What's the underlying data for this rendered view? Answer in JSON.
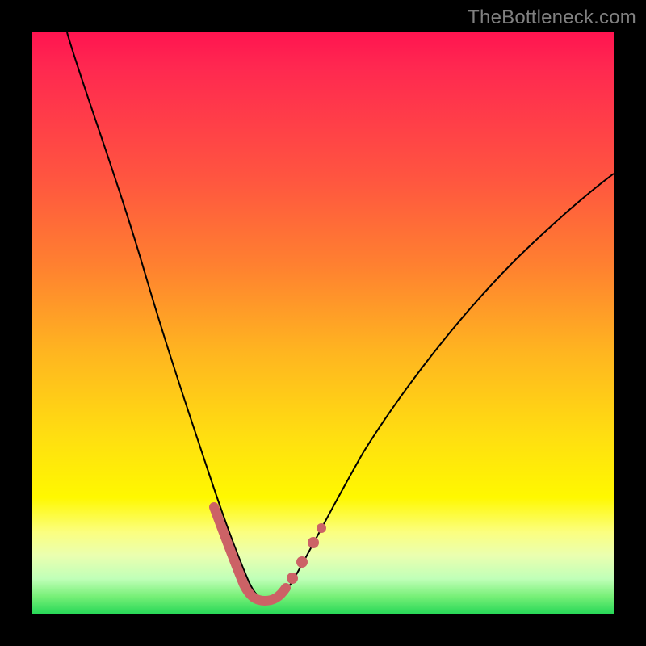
{
  "watermark": "TheBottleneck.com",
  "chart_data": {
    "type": "line",
    "title": "",
    "xlabel": "",
    "ylabel": "",
    "xlim": [
      0,
      100
    ],
    "ylim": [
      0,
      100
    ],
    "grid": false,
    "series": [
      {
        "name": "bottleneck-curve",
        "x": [
          6,
          9,
          12,
          15,
          18,
          21,
          23,
          25,
          27,
          29,
          31,
          33,
          35,
          36,
          37,
          38,
          39,
          41,
          43,
          45,
          48,
          52,
          57,
          63,
          70,
          78,
          86,
          94,
          100
        ],
        "y": [
          100,
          93,
          83,
          73,
          62,
          52,
          44,
          37,
          30,
          24,
          19,
          14,
          10,
          7,
          5,
          4,
          3,
          3,
          4,
          6,
          10,
          15,
          22,
          30,
          38,
          46,
          54,
          61,
          67
        ]
      }
    ],
    "highlight_segment": {
      "name": "bottom-pink-band",
      "x": [
        31,
        33,
        35,
        36,
        37,
        38,
        39,
        41,
        43,
        45,
        48
      ],
      "y": [
        19,
        14,
        10,
        7,
        5,
        4,
        3,
        3,
        4,
        6,
        10
      ]
    },
    "annotations": [],
    "background_gradient": {
      "top_color": "#ff1450",
      "mid_colors": [
        "#ff8030",
        "#ffe010",
        "#fff800"
      ],
      "bottom_color": "#28d858"
    }
  }
}
